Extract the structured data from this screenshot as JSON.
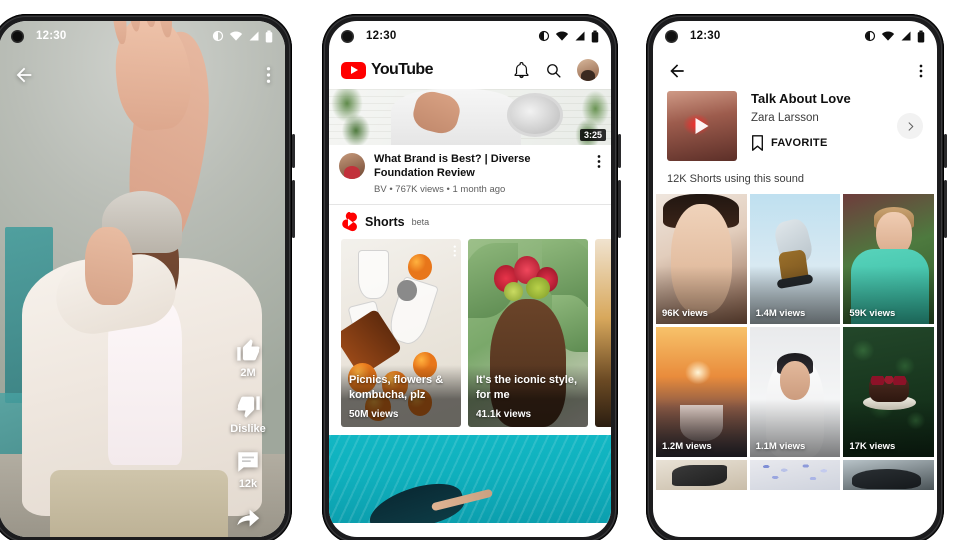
{
  "statusbar": {
    "time": "12:30",
    "icons": [
      "contrast-icon",
      "wifi-icon",
      "signal-icon",
      "battery-icon"
    ]
  },
  "phone1": {
    "name": "Shorts player",
    "back_icon": "back-arrow-icon",
    "menu_icon": "more-vertical-icon",
    "actions": [
      {
        "icon": "thumbs-up-icon",
        "label": "2M"
      },
      {
        "icon": "thumbs-down-icon",
        "label": "Dislike"
      },
      {
        "icon": "comment-icon",
        "label": "12k"
      },
      {
        "icon": "share-icon",
        "label": ""
      }
    ]
  },
  "phone2": {
    "name": "YouTube home feed",
    "header": {
      "logo_text": "YouTube",
      "logo_icon": "youtube-play-badge",
      "notifications_icon": "bell-icon",
      "search_icon": "search-icon",
      "account_icon": "account-avatar"
    },
    "video": {
      "title": "What Brand is Best? | Diverse Foundation Review",
      "channel": "BV",
      "views": "767K views",
      "age": "1 month ago",
      "meta_separator": "•",
      "duration": "3:25",
      "menu_icon": "more-vertical-icon"
    },
    "shorts_shelf": {
      "logo_icon": "shorts-logo-icon",
      "title": "Shorts",
      "badge": "beta",
      "cards": [
        {
          "title": "Picnics, flowers & kombucha, plz",
          "views": "50M views",
          "menu_icon": "more-vertical-icon"
        },
        {
          "title": "It's the iconic style, for me",
          "views": "41.1k views",
          "menu_icon": "more-vertical-icon"
        }
      ]
    }
  },
  "phone3": {
    "name": "Sound detail page",
    "back_icon": "back-arrow-icon",
    "menu_icon": "more-vertical-icon",
    "sound": {
      "title": "Talk About Love",
      "artist": "Zara Larsson",
      "favorite_label": "FAVORITE",
      "favorite_icon": "bookmark-icon",
      "play_icon": "play-icon",
      "chevron_icon": "chevron-right-icon"
    },
    "shorts_count": "12K Shorts using this sound",
    "grid": [
      {
        "views": "96K views"
      },
      {
        "views": "1.4M views"
      },
      {
        "views": "59K views"
      },
      {
        "views": "1.2M views"
      },
      {
        "views": "1.1M views"
      },
      {
        "views": "17K views"
      }
    ]
  },
  "colors": {
    "brand_red": "#ff0000",
    "text_primary": "#0f0f0f",
    "text_secondary": "#606060",
    "page_bg": "#ffffff"
  }
}
